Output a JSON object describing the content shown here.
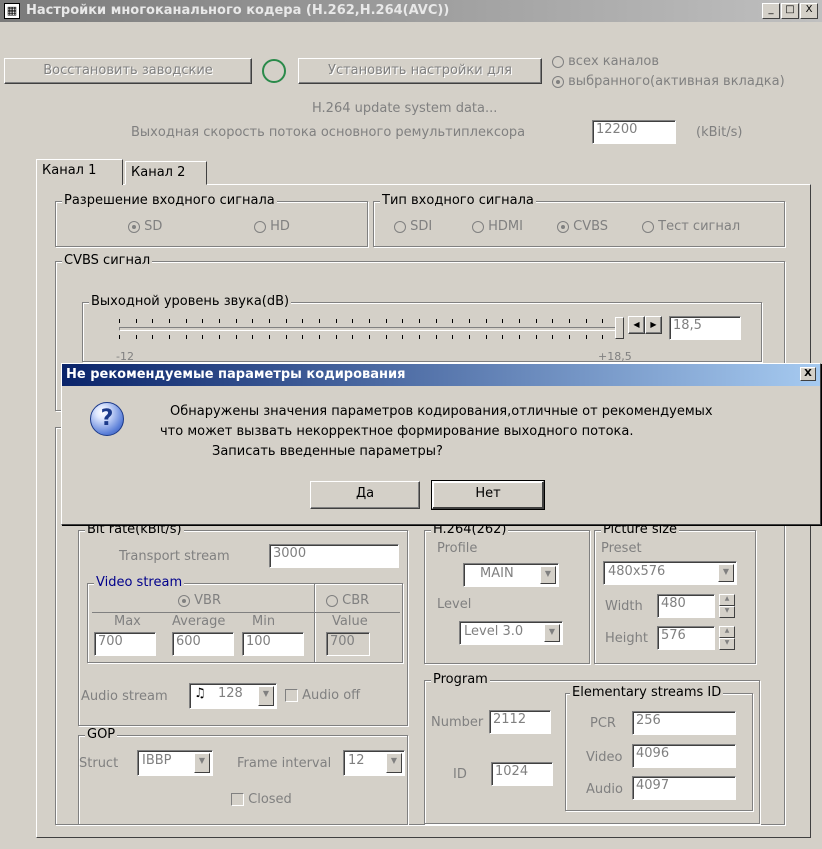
{
  "window": {
    "title": "Настройки многоканального  кодера (H.262,H.264(AVC))",
    "app_icon": "encoder-app-icon",
    "buttons": {
      "minimize": "_",
      "maximize": "□",
      "close": "X"
    }
  },
  "top": {
    "restore_button": "Восстановить заводские",
    "apply_button": "Установить настройки для",
    "scope_all": "всех каналов",
    "scope_selected": "выбранного(активная вкладка)",
    "scope_selected_checked": true,
    "update_text": "H.264 update system data...",
    "bitrate_label": "Выходная скорость потока  основного ремультиплексора",
    "bitrate_value": "12200",
    "bitrate_unit": "(kBit/s)"
  },
  "tabs": [
    {
      "label": "Канал 1",
      "active": true
    },
    {
      "label": "Канал 2",
      "active": false
    }
  ],
  "input_resolution": {
    "legend": "Разрешение входного сигнала",
    "options": [
      "SD",
      "HD"
    ],
    "selected": "SD"
  },
  "input_type": {
    "legend": "Тип входного сигнала",
    "options": [
      "SDI",
      "HDMI",
      "CVBS",
      "Тест сигнал"
    ],
    "selected": "CVBS"
  },
  "cvbs": {
    "legend": "CVBS сигнал",
    "audio_level_legend": "Выходной уровень звука(dB)",
    "audio_level_value": "18,5",
    "audio_level_min_label": "-12",
    "audio_level_max_label": "+18,5",
    "slider_fraction": 1.0
  },
  "bitrate": {
    "legend": "Bit rate(kBit/s)",
    "transport_label": "Transport stream",
    "transport_value": "3000",
    "video_legend": "Video stream",
    "vbr_label": "VBR",
    "cbr_label": "CBR",
    "max_label": "Max",
    "avg_label": "Average",
    "min_label": "Min",
    "value_label": "Value",
    "max_value": "700",
    "avg_value": "600",
    "min_value": "100",
    "cbr_value": "700",
    "audio_label": "Audio stream",
    "audio_value": "128",
    "audio_icon": "music-note-icon",
    "audio_off_label": "Audio off"
  },
  "h264": {
    "legend": "H.264(262)",
    "profile_label": "Profile",
    "profile_value": "MAIN",
    "level_label": "Level",
    "level_value": "Level 3.0"
  },
  "picture": {
    "legend": "Picture size",
    "preset_label": "Preset",
    "preset_value": "480x576",
    "width_label": "Width",
    "width_value": "480",
    "height_label": "Height",
    "height_value": "576"
  },
  "gop": {
    "legend": "GOP",
    "struct_label": "Struct",
    "struct_value": "IBBP",
    "interval_label": "Frame interval",
    "interval_value": "12",
    "closed_label": "Closed"
  },
  "program": {
    "legend": "Program",
    "number_label": "Number",
    "number_value": "2112",
    "id_label": "ID",
    "id_value": "1024"
  },
  "es": {
    "legend": "Elementary streams ID",
    "pcr_label": "PCR",
    "pcr_value": "256",
    "video_label": "Video",
    "video_value": "4096",
    "audio_label": "Audio",
    "audio_value": "4097"
  },
  "dialog": {
    "title": "Не рекомендуемые параметры кодирования",
    "close": "X",
    "icon": "question-icon",
    "line1": "Обнаружены значения  параметров кодирования,отличные от рекомендуемых",
    "line2": "что может вызвать  некорректное формирование выходного потока.",
    "line3": "Записать введенные параметры?",
    "yes": "Да",
    "no": "Нет"
  }
}
